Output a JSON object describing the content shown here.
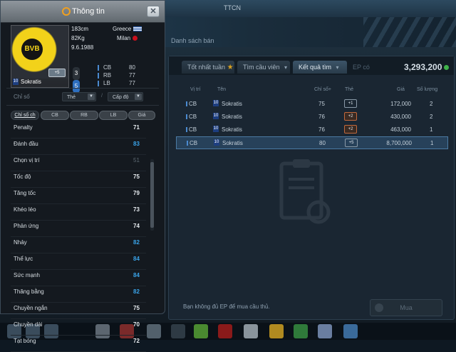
{
  "window": {
    "title": "TTCN"
  },
  "subheader": {
    "title": "Danh sách bán"
  },
  "tabs": [
    {
      "label": "Tốt nhất tuần",
      "icon": "star-icon"
    },
    {
      "label": "Tìm cầu viên",
      "icon": "chevron-down-icon"
    },
    {
      "label": "Kết quả tìm",
      "icon": "chevron-down-icon"
    },
    {
      "label": "EP có"
    }
  ],
  "ep_balance": "3,293,200",
  "results_table": {
    "headers": [
      "Vị trí",
      "Tên",
      "Chỉ số+",
      "Thẻ",
      "Giá",
      "Số lượng"
    ],
    "rows": [
      {
        "pos": "CB",
        "nat": "10",
        "name": "Sokratis",
        "stat": "75",
        "badge": "+1",
        "price": "172,000",
        "qty": "2"
      },
      {
        "pos": "CB",
        "nat": "10",
        "name": "Sokratis",
        "stat": "76",
        "badge": "+2",
        "price": "430,000",
        "qty": "2"
      },
      {
        "pos": "CB",
        "nat": "10",
        "name": "Sokratis",
        "stat": "76",
        "badge": "+2",
        "price": "463,000",
        "qty": "1"
      },
      {
        "pos": "CB",
        "nat": "10",
        "name": "Sokratis",
        "stat": "80",
        "badge": "+5",
        "price": "8,700,000",
        "qty": "1"
      }
    ]
  },
  "footer": {
    "message": "Bạn không đủ EP để mua cầu thủ.",
    "buy_label": "Mua"
  },
  "popup": {
    "title": "Thông tin",
    "close_label": "✕",
    "card": {
      "name": "Sokratis",
      "nat": "10",
      "upgrade": "+5",
      "club_logo": "BVB"
    },
    "height": "183cm",
    "weight": "82Kg",
    "dob": "9.6.1988",
    "country": "Greece",
    "team": "Milan",
    "ovr_digits": [
      "3",
      "5"
    ],
    "positions": [
      {
        "pos": "CB",
        "value": "80"
      },
      {
        "pos": "RB",
        "value": "77"
      },
      {
        "pos": "LB",
        "value": "77"
      }
    ],
    "filter_label": "Chỉ số",
    "select1": "Thẻ",
    "select2": "Cấp độ",
    "slash": "/",
    "chip_tabs": [
      "Chỉ số ch",
      "CB",
      "RB",
      "LB",
      "Giá"
    ],
    "stats": [
      {
        "label": "Penalty",
        "value": "71",
        "style": "normal"
      },
      {
        "label": "Đánh đầu",
        "value": "83",
        "style": "blue"
      },
      {
        "label": "Chọn vị trí",
        "value": "51",
        "style": "dim"
      },
      {
        "label": "Tốc độ",
        "value": "75",
        "style": "normal"
      },
      {
        "label": "Tăng tốc",
        "value": "79",
        "style": "normal"
      },
      {
        "label": "Khéo léo",
        "value": "73",
        "style": "normal"
      },
      {
        "label": "Phản ứng",
        "value": "74",
        "style": "normal"
      },
      {
        "label": "Nhảy",
        "value": "82",
        "style": "blue"
      },
      {
        "label": "Thể lực",
        "value": "84",
        "style": "blue"
      },
      {
        "label": "Sức mạnh",
        "value": "84",
        "style": "blue"
      },
      {
        "label": "Thăng bằng",
        "value": "82",
        "style": "blue"
      },
      {
        "label": "Chuyền ngắn",
        "value": "75",
        "style": "normal"
      },
      {
        "label": "Chuyền dài",
        "value": "70",
        "style": "normal"
      },
      {
        "label": "Tạt bóng",
        "value": "72",
        "style": "normal"
      }
    ]
  },
  "colors": {
    "accent_blue": "#3aa4ea",
    "ep_green": "#3fb34a",
    "title_icon": "#f0a020"
  }
}
